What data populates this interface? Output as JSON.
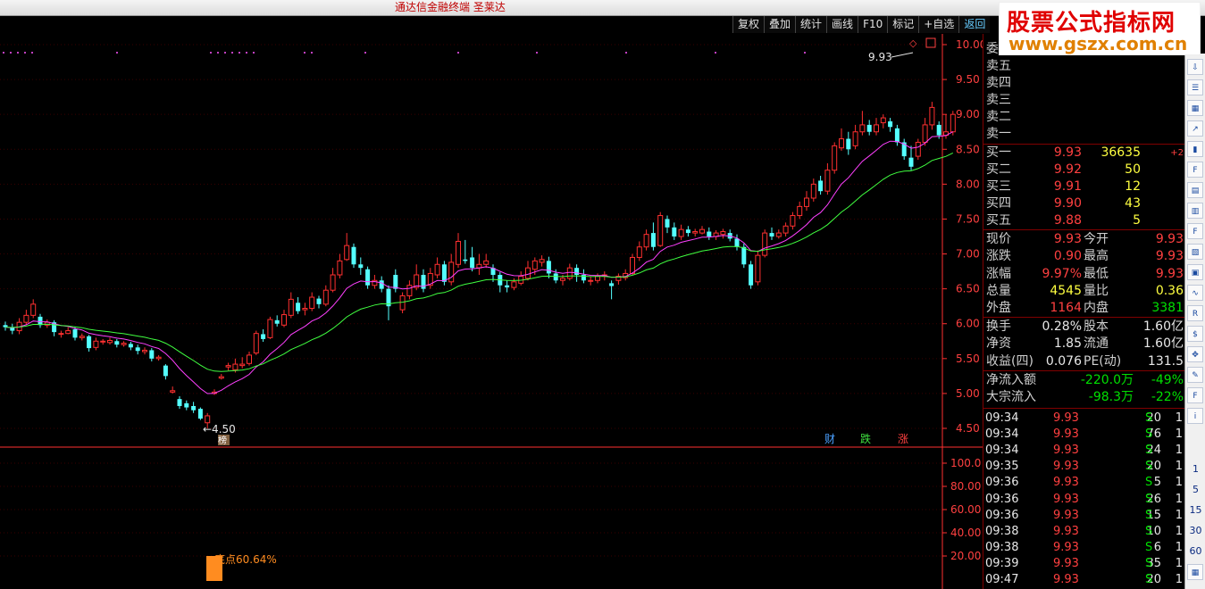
{
  "window": {
    "title": "通达信金融终端 圣莱达"
  },
  "watermark": {
    "line1": "股票公式指标网",
    "line2": "www.gszx.com.cn"
  },
  "toolbar": [
    "复权",
    "叠加",
    "统计",
    "画线",
    "F10",
    "标记",
    "+自选",
    "返回"
  ],
  "colors": {
    "up": "#ff3030",
    "down": "#54ffff",
    "ma1": "#ff40ff",
    "ma2": "#40ff40",
    "grid": "#800000",
    "axis": "#ff3030"
  },
  "chart_data": {
    "type": "candlestick",
    "main_y_ticks": [
      "10.00",
      "9.50",
      "9.00",
      "8.50",
      "8.00",
      "7.50",
      "7.00",
      "6.50",
      "6.00",
      "5.50",
      "5.00",
      "4.50"
    ],
    "ylim": [
      4.4,
      10.1
    ],
    "sub_y_ticks": [
      "100.0",
      "80.00",
      "60.00",
      "40.00",
      "20.00"
    ],
    "annotations": {
      "high_label": "9.93",
      "low_label": "4.50",
      "bottom_label": "底点60.64%",
      "bottom_value": 60.64,
      "tags": [
        "财",
        "跌",
        "涨"
      ],
      "marker": "榜"
    },
    "candles": [
      [
        5.98,
        5.95,
        6.03,
        5.9
      ],
      [
        5.95,
        5.9,
        6.0,
        5.85
      ],
      [
        5.9,
        6.02,
        6.08,
        5.85
      ],
      [
        6.02,
        6.12,
        6.2,
        5.98
      ],
      [
        6.12,
        6.28,
        6.35,
        6.08
      ],
      [
        6.1,
        5.98,
        6.14,
        5.94
      ],
      [
        5.98,
        6.02,
        6.06,
        5.94
      ],
      [
        6.02,
        5.88,
        6.05,
        5.82
      ],
      [
        5.85,
        5.86,
        5.9,
        5.8
      ],
      [
        5.86,
        5.9,
        5.95,
        5.85
      ],
      [
        5.92,
        5.8,
        5.95,
        5.76
      ],
      [
        5.8,
        5.82,
        5.86,
        5.76
      ],
      [
        5.82,
        5.65,
        5.84,
        5.6
      ],
      [
        5.66,
        5.75,
        5.8,
        5.62
      ],
      [
        5.74,
        5.75,
        5.78,
        5.7
      ],
      [
        5.73,
        5.76,
        5.8,
        5.7
      ],
      [
        5.75,
        5.7,
        5.78,
        5.66
      ],
      [
        5.7,
        5.72,
        5.75,
        5.67
      ],
      [
        5.71,
        5.66,
        5.74,
        5.62
      ],
      [
        5.66,
        5.61,
        5.7,
        5.56
      ],
      [
        5.6,
        5.62,
        5.66,
        5.56
      ],
      [
        5.62,
        5.5,
        5.65,
        5.46
      ],
      [
        5.5,
        5.52,
        5.55,
        5.47
      ],
      [
        5.4,
        5.25,
        5.42,
        5.2
      ],
      [
        5.02,
        5.04,
        5.1,
        5.0
      ],
      [
        4.92,
        4.82,
        4.96,
        4.78
      ],
      [
        4.86,
        4.8,
        4.9,
        4.76
      ],
      [
        4.82,
        4.76,
        4.88,
        4.72
      ],
      [
        4.78,
        4.64,
        4.8,
        4.62
      ],
      [
        4.58,
        4.68,
        4.72,
        4.5
      ],
      [
        5.0,
        5.02,
        5.06,
        4.98
      ],
      [
        5.22,
        5.24,
        5.28,
        5.2
      ],
      [
        5.38,
        5.4,
        5.44,
        5.33
      ],
      [
        5.34,
        5.42,
        5.5,
        5.3
      ],
      [
        5.4,
        5.42,
        5.52,
        5.36
      ],
      [
        5.43,
        5.55,
        5.6,
        5.4
      ],
      [
        5.58,
        5.86,
        5.9,
        5.55
      ],
      [
        5.85,
        5.78,
        5.92,
        5.74
      ],
      [
        5.8,
        6.06,
        6.1,
        5.78
      ],
      [
        6.05,
        6.0,
        6.12,
        5.96
      ],
      [
        5.98,
        6.13,
        6.2,
        5.95
      ],
      [
        6.12,
        6.35,
        6.45,
        6.08
      ],
      [
        6.3,
        6.18,
        6.38,
        6.14
      ],
      [
        6.2,
        6.22,
        6.3,
        6.12
      ],
      [
        6.22,
        6.38,
        6.45,
        6.18
      ],
      [
        6.36,
        6.28,
        6.4,
        6.22
      ],
      [
        6.28,
        6.48,
        6.55,
        6.25
      ],
      [
        6.48,
        6.7,
        6.8,
        6.45
      ],
      [
        6.7,
        6.9,
        7.0,
        6.65
      ],
      [
        6.92,
        7.12,
        7.3,
        6.9
      ],
      [
        7.1,
        6.85,
        7.15,
        6.8
      ],
      [
        6.85,
        6.8,
        6.95,
        6.7
      ],
      [
        6.78,
        6.55,
        6.82,
        6.5
      ],
      [
        6.55,
        6.62,
        6.7,
        6.5
      ],
      [
        6.62,
        6.5,
        6.68,
        6.45
      ],
      [
        6.5,
        6.25,
        6.55,
        6.05
      ],
      [
        6.7,
        6.5,
        6.78,
        6.45
      ],
      [
        6.2,
        6.4,
        6.45,
        6.15
      ],
      [
        6.4,
        6.55,
        6.62,
        6.35
      ],
      [
        6.52,
        6.7,
        6.85,
        6.48
      ],
      [
        6.7,
        6.5,
        6.78,
        6.45
      ],
      [
        6.55,
        6.72,
        6.8,
        6.5
      ],
      [
        6.7,
        6.85,
        6.95,
        6.65
      ],
      [
        6.85,
        6.6,
        6.9,
        6.55
      ],
      [
        6.6,
        6.88,
        7.0,
        6.55
      ],
      [
        6.85,
        7.18,
        7.3,
        6.8
      ],
      [
        6.92,
        6.9,
        7.2,
        6.86
      ],
      [
        6.95,
        6.8,
        7.1,
        6.75
      ],
      [
        6.8,
        6.85,
        7.0,
        6.7
      ],
      [
        6.85,
        6.9,
        7.0,
        6.8
      ],
      [
        6.8,
        6.7,
        6.85,
        6.6
      ],
      [
        6.7,
        6.55,
        6.74,
        6.45
      ],
      [
        6.55,
        6.52,
        6.62,
        6.45
      ],
      [
        6.52,
        6.6,
        6.65,
        6.48
      ],
      [
        6.58,
        6.68,
        6.75,
        6.55
      ],
      [
        6.65,
        6.8,
        6.9,
        6.62
      ],
      [
        6.78,
        6.9,
        6.95,
        6.7
      ],
      [
        6.88,
        6.92,
        6.98,
        6.82
      ],
      [
        6.9,
        6.72,
        6.96,
        6.65
      ],
      [
        6.72,
        6.62,
        6.78,
        6.58
      ],
      [
        6.62,
        6.65,
        6.7,
        6.55
      ],
      [
        6.65,
        6.8,
        6.86,
        6.62
      ],
      [
        6.8,
        6.7,
        6.85,
        6.6
      ],
      [
        6.7,
        6.62,
        6.78,
        6.58
      ],
      [
        6.62,
        6.62,
        6.68,
        6.55
      ],
      [
        6.62,
        6.68,
        6.72,
        6.58
      ],
      [
        6.68,
        6.7,
        6.75,
        6.62
      ],
      [
        6.58,
        6.54,
        6.62,
        6.35
      ],
      [
        6.62,
        6.68,
        6.72,
        6.56
      ],
      [
        6.66,
        6.72,
        6.78,
        6.62
      ],
      [
        6.72,
        6.95,
        7.0,
        6.7
      ],
      [
        6.95,
        7.1,
        7.18,
        6.9
      ],
      [
        7.1,
        7.28,
        7.35,
        7.05
      ],
      [
        7.3,
        7.1,
        7.45,
        7.05
      ],
      [
        7.12,
        7.55,
        7.6,
        7.1
      ],
      [
        7.5,
        7.38,
        7.55,
        7.3
      ],
      [
        7.38,
        7.25,
        7.45,
        7.2
      ],
      [
        7.25,
        7.35,
        7.42,
        7.2
      ],
      [
        7.35,
        7.3,
        7.4,
        7.25
      ],
      [
        7.3,
        7.32,
        7.36,
        7.25
      ],
      [
        7.3,
        7.35,
        7.4,
        7.28
      ],
      [
        7.32,
        7.25,
        7.38,
        7.2
      ],
      [
        7.25,
        7.3,
        7.34,
        7.2
      ],
      [
        7.28,
        7.32,
        7.36,
        7.22
      ],
      [
        7.3,
        7.22,
        7.35,
        7.18
      ],
      [
        7.22,
        7.1,
        7.28,
        7.05
      ],
      [
        7.1,
        6.85,
        7.15,
        6.8
      ],
      [
        6.85,
        6.55,
        6.9,
        6.5
      ],
      [
        6.6,
        6.98,
        7.05,
        6.55
      ],
      [
        6.98,
        7.3,
        7.35,
        6.95
      ],
      [
        7.3,
        7.25,
        7.38,
        7.2
      ],
      [
        7.25,
        7.3,
        7.35,
        7.22
      ],
      [
        7.3,
        7.4,
        7.45,
        7.25
      ],
      [
        7.4,
        7.55,
        7.6,
        7.35
      ],
      [
        7.55,
        7.68,
        7.75,
        7.5
      ],
      [
        7.68,
        7.8,
        7.9,
        7.62
      ],
      [
        7.8,
        8.0,
        8.08,
        7.75
      ],
      [
        8.05,
        7.9,
        8.12,
        7.85
      ],
      [
        7.9,
        8.2,
        8.3,
        7.85
      ],
      [
        8.2,
        8.55,
        8.6,
        8.15
      ],
      [
        8.52,
        8.65,
        8.8,
        8.48
      ],
      [
        8.65,
        8.5,
        8.75,
        8.42
      ],
      [
        8.55,
        8.75,
        8.85,
        8.5
      ],
      [
        8.75,
        8.85,
        9.05,
        8.7
      ],
      [
        8.85,
        8.75,
        8.92,
        8.7
      ],
      [
        8.75,
        8.85,
        8.95,
        8.7
      ],
      [
        8.88,
        8.95,
        9.0,
        8.8
      ],
      [
        8.9,
        8.82,
        8.95,
        8.75
      ],
      [
        8.8,
        8.6,
        8.85,
        8.55
      ],
      [
        8.6,
        8.4,
        8.65,
        8.35
      ],
      [
        8.38,
        8.25,
        8.55,
        8.2
      ],
      [
        8.4,
        8.6,
        8.65,
        8.35
      ],
      [
        8.6,
        8.85,
        8.95,
        8.55
      ],
      [
        8.85,
        9.1,
        9.18,
        8.78
      ],
      [
        8.85,
        8.7,
        8.9,
        8.65
      ],
      [
        8.7,
        8.75,
        9.0,
        8.65
      ],
      [
        8.75,
        9.0,
        9.05,
        8.7
      ]
    ]
  },
  "panel": {
    "sell_header": "委",
    "sells": [
      "卖五",
      "卖四",
      "卖三",
      "卖二",
      "卖一"
    ],
    "buy_extra": "+2",
    "buys": [
      {
        "label": "买一",
        "price": "9.93",
        "qty": "36635"
      },
      {
        "label": "买二",
        "price": "9.92",
        "qty": "50"
      },
      {
        "label": "买三",
        "price": "9.91",
        "qty": "12"
      },
      {
        "label": "买四",
        "price": "9.90",
        "qty": "43"
      },
      {
        "label": "买五",
        "price": "9.88",
        "qty": "5"
      }
    ],
    "quote": [
      {
        "l1": "现价",
        "v1": "9.93",
        "l2": "今开",
        "v2": "9.93"
      },
      {
        "l1": "涨跌",
        "v1": "0.90",
        "l2": "最高",
        "v2": "9.93"
      },
      {
        "l1": "涨幅",
        "v1": "9.97%",
        "l2": "最低",
        "v2": "9.93"
      },
      {
        "l1": "总量",
        "v1": "4545",
        "l2": "量比",
        "v2": "0.36"
      },
      {
        "l1": "外盘",
        "v1": "1164",
        "l2": "内盘",
        "v2": "3381"
      }
    ],
    "fundamentals": [
      {
        "l1": "换手",
        "v1": "0.28%",
        "l2": "股本",
        "v2": "1.60亿"
      },
      {
        "l1": "净资",
        "v1": "1.85",
        "l2": "流通",
        "v2": "1.60亿"
      },
      {
        "l1": "收益(四)",
        "v1": "0.076",
        "l2": "PE(动)",
        "v2": "131.5"
      }
    ],
    "flows": [
      {
        "label": "净流入额",
        "value": "-220.0万",
        "pct": "-49%"
      },
      {
        "label": "大宗流入",
        "value": "-98.3万",
        "pct": "-22%"
      }
    ],
    "ticks": [
      [
        "09:34",
        "9.93",
        "20",
        "S",
        "1"
      ],
      [
        "09:34",
        "9.93",
        "76",
        "S",
        "1"
      ],
      [
        "09:34",
        "9.93",
        "24",
        "S",
        "1"
      ],
      [
        "09:35",
        "9.93",
        "20",
        "S",
        "1"
      ],
      [
        "09:36",
        "9.93",
        "5",
        "S",
        "1"
      ],
      [
        "09:36",
        "9.93",
        "26",
        "S",
        "1"
      ],
      [
        "09:36",
        "9.93",
        "15",
        "S",
        "1"
      ],
      [
        "09:38",
        "9.93",
        "10",
        "S",
        "1"
      ],
      [
        "09:38",
        "9.93",
        "6",
        "S",
        "1"
      ],
      [
        "09:39",
        "9.93",
        "35",
        "S",
        "1"
      ],
      [
        "09:47",
        "9.93",
        "20",
        "S",
        "1"
      ]
    ]
  },
  "rightbar": {
    "icons": [
      "down-arrow-icon",
      "list-icon",
      "grid-icon",
      "trend-icon",
      "kline-icon",
      "f10-icon",
      "page-icon",
      "doc-icon",
      "f12-icon",
      "sheet-icon",
      "box-icon",
      "wave-icon",
      "rsi-icon",
      "s-icon",
      "move-icon",
      "pen-icon",
      "f5-icon",
      "info-icon"
    ],
    "periods": [
      "1",
      "5",
      "15",
      "30",
      "60"
    ]
  }
}
